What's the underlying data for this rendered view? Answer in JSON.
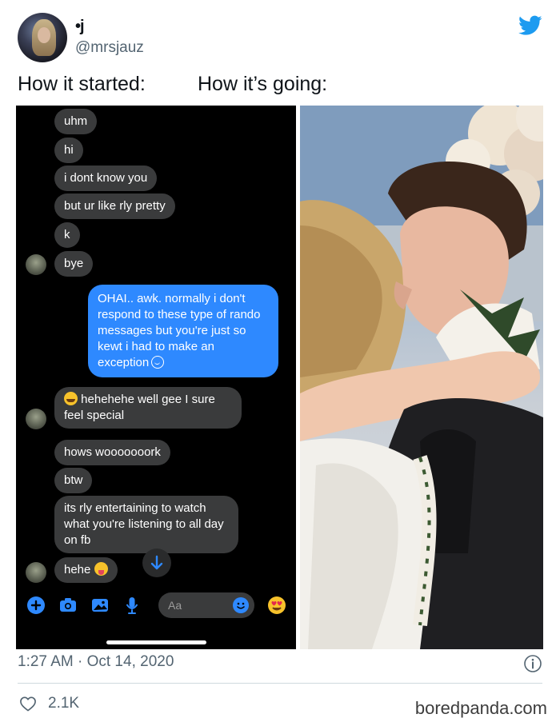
{
  "tweet": {
    "display_name": "•j",
    "handle": "@mrsjauz",
    "caption_left": "How it started:",
    "caption_right": "How it’s going:",
    "timestamp": "1:27 AM · Oct 14, 2020",
    "likes": "2.1K"
  },
  "chat": {
    "messages": [
      {
        "text": "uhm",
        "type": "received"
      },
      {
        "text": "hi",
        "type": "received"
      },
      {
        "text": "i dont know you",
        "type": "received"
      },
      {
        "text": "but ur like rly pretty",
        "type": "received"
      },
      {
        "text": "k",
        "type": "received"
      },
      {
        "text": "bye",
        "type": "received"
      },
      {
        "text": "OHAI.. awk. normally i don't respond to these type of rando messages but you're just so kewt i had to make an exception",
        "type": "sent"
      },
      {
        "text": "hehehehe well gee I sure feel special",
        "type": "received",
        "emoji": "grin"
      },
      {
        "text": "hows wooooooork",
        "type": "received"
      },
      {
        "text": "btw",
        "type": "received"
      },
      {
        "text": "its rly entertaining to watch what you're listening to all day on fb",
        "type": "received"
      },
      {
        "text": "hehe",
        "type": "received",
        "emoji": "tongue"
      }
    ],
    "input_placeholder": "Aa"
  },
  "watermark": "boredpanda.com",
  "colors": {
    "twitter_blue": "#1d9bf0",
    "sent_bubble": "#2e89ff",
    "received_bubble": "#3a3b3c",
    "messenger_blue": "#2e89ff"
  },
  "icons": [
    "twitter-logo",
    "plus-icon",
    "camera-icon",
    "image-icon",
    "microphone-icon",
    "smiley-icon",
    "heart-eyes-emoji-icon",
    "arrow-down-icon",
    "info-icon",
    "heart-icon"
  ]
}
